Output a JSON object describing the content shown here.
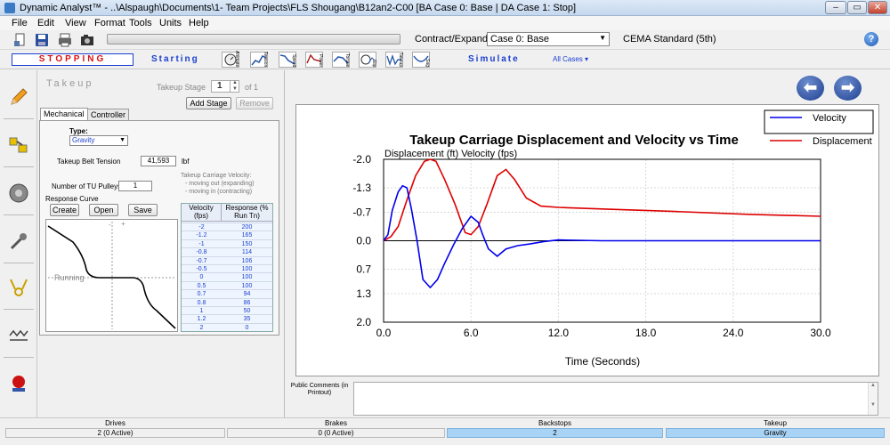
{
  "window": {
    "title": "Dynamic Analyst™ - ..\\Alspaugh\\Documents\\1- Team Projects\\FLS Shougang\\B12an2-C00 [BA Case 0: Base | DA Case 1: Stop]",
    "minimize": "–",
    "maximize": "▭",
    "close": "✕"
  },
  "menu": [
    "File",
    "Edit",
    "View",
    "Format",
    "Tools",
    "Units",
    "Help"
  ],
  "toolbar": {
    "contract_expand": "Contract/Expand",
    "case_select": "Case 0: Base",
    "standard": "CEMA Standard (5th)",
    "help": "?"
  },
  "sim_toolbar": {
    "stopping": "STOPPING",
    "starting": "Starting",
    "simulate": "Simulate",
    "all_cases": "All Cases ▾",
    "icons": [
      {
        "name": "animate-icon",
        "label": "Animate"
      },
      {
        "name": "tension-icon",
        "label": "Tension"
      },
      {
        "name": "speed-icon",
        "label": "Speed"
      },
      {
        "name": "power-icon",
        "label": "Power"
      },
      {
        "name": "torque-icon",
        "label": "Torque"
      },
      {
        "name": "slip-icon",
        "label": "Slip"
      },
      {
        "name": "takeup-icon",
        "label": "Takeup"
      },
      {
        "name": "sag-icon",
        "label": "Sag"
      }
    ]
  },
  "takeup": {
    "title": "Takeup",
    "stage_label": "Takeup Stage",
    "stage_value": "1",
    "stage_of": "of 1",
    "add_stage": "Add Stage",
    "remove": "Remove",
    "tabs": [
      "Mechanical",
      "Controller"
    ],
    "type_label": "Type:",
    "type_value": "Gravity",
    "belt_tension_label": "Takeup Belt Tension",
    "belt_tension_value": "41,593",
    "belt_tension_unit": "lbf",
    "pulleys_label": "Number of TU Pulleys",
    "pulleys_value": "1",
    "velocity_note": "Takeup Carriage Velocity:",
    "velocity_note_1": "-  moving out (expanding)",
    "velocity_note_2": "-  moving in (contracting)",
    "response_curve_label": "Response Curve",
    "create": "Create",
    "open": "Open",
    "save": "Save",
    "plot_minus": "-",
    "plot_plus": "+",
    "plot_running": "Running",
    "table_header_velocity": "Velocity (fps)",
    "table_header_response": "Response (% Run Tn)",
    "table_rows": [
      [
        "-2",
        "200"
      ],
      [
        "-1.2",
        "165"
      ],
      [
        "-1",
        "150"
      ],
      [
        "-0.8",
        "114"
      ],
      [
        "-0.7",
        "106"
      ],
      [
        "-0.5",
        "100"
      ],
      [
        "0",
        "100"
      ],
      [
        "0.5",
        "100"
      ],
      [
        "0.7",
        "94"
      ],
      [
        "0.8",
        "86"
      ],
      [
        "1",
        "50"
      ],
      [
        "1.2",
        "35"
      ],
      [
        "2",
        "0"
      ]
    ]
  },
  "chart_data": {
    "type": "line",
    "title": "Takeup Carriage Displacement and Velocity vs Time",
    "ylabel": "Displacement (ft)  Velocity (fps)",
    "xlabel": "Time (Seconds)",
    "xlim": [
      0,
      30
    ],
    "ylim": [
      -2.0,
      2.0
    ],
    "y_inverted": true,
    "x_ticks": [
      "0.0",
      "6.0",
      "12.0",
      "18.0",
      "24.0",
      "30.0"
    ],
    "y_ticks": [
      "-2.0",
      "-1.3",
      "-0.7",
      "0.0",
      "0.7",
      "1.3",
      "2.0"
    ],
    "legend_position": "top-right",
    "series": [
      {
        "name": "Velocity",
        "color": "#0000ee",
        "x": [
          0,
          0.3,
          0.6,
          1.0,
          1.3,
          1.6,
          1.9,
          2.3,
          2.7,
          3.2,
          3.7,
          4.2,
          4.8,
          5.4,
          6.0,
          6.5,
          6.8,
          7.2,
          7.8,
          8.4,
          9.2,
          10.0,
          11.0,
          12.0,
          15.0,
          20.0,
          25.0,
          30.0
        ],
        "values": [
          0,
          -0.15,
          -0.75,
          -1.2,
          -1.35,
          -1.3,
          -0.8,
          0.0,
          0.95,
          1.15,
          0.95,
          0.55,
          0.1,
          -0.3,
          -0.6,
          -0.45,
          -0.15,
          0.2,
          0.38,
          0.2,
          0.12,
          0.08,
          0.02,
          -0.02,
          0.0,
          0.0,
          0.0,
          0.0
        ]
      },
      {
        "name": "Displacement",
        "color": "#dd0000",
        "x": [
          0,
          0.5,
          1.0,
          1.6,
          2.2,
          2.8,
          3.2,
          3.6,
          4.2,
          4.9,
          5.6,
          6.0,
          6.5,
          7.1,
          7.8,
          8.4,
          9.0,
          9.8,
          10.8,
          12.0,
          15.0,
          20.0,
          25.0,
          30.0
        ],
        "values": [
          0,
          -0.1,
          -0.35,
          -1.0,
          -1.6,
          -1.95,
          -2.0,
          -1.95,
          -1.5,
          -0.9,
          -0.2,
          -0.15,
          -0.35,
          -0.9,
          -1.6,
          -1.75,
          -1.5,
          -1.05,
          -0.85,
          -0.82,
          -0.78,
          -0.72,
          -0.65,
          -0.6
        ]
      }
    ]
  },
  "comments": {
    "label": "Public Comments (in Printout)",
    "scroll_up": "▲",
    "scroll_down": "▼"
  },
  "status": {
    "drives_label": "Drives",
    "drives_value": "2 (0 Active)",
    "brakes_label": "Brakes",
    "brakes_value": "0 (0 Active)",
    "backstops_label": "Backstops",
    "backstops_value": "2",
    "takeup_label": "Takeup",
    "takeup_value": "Gravity"
  },
  "colors": {
    "accent_blue": "#1a3fd0",
    "stop_red": "#dd1111",
    "status_highlight": "#a9d3f5"
  }
}
